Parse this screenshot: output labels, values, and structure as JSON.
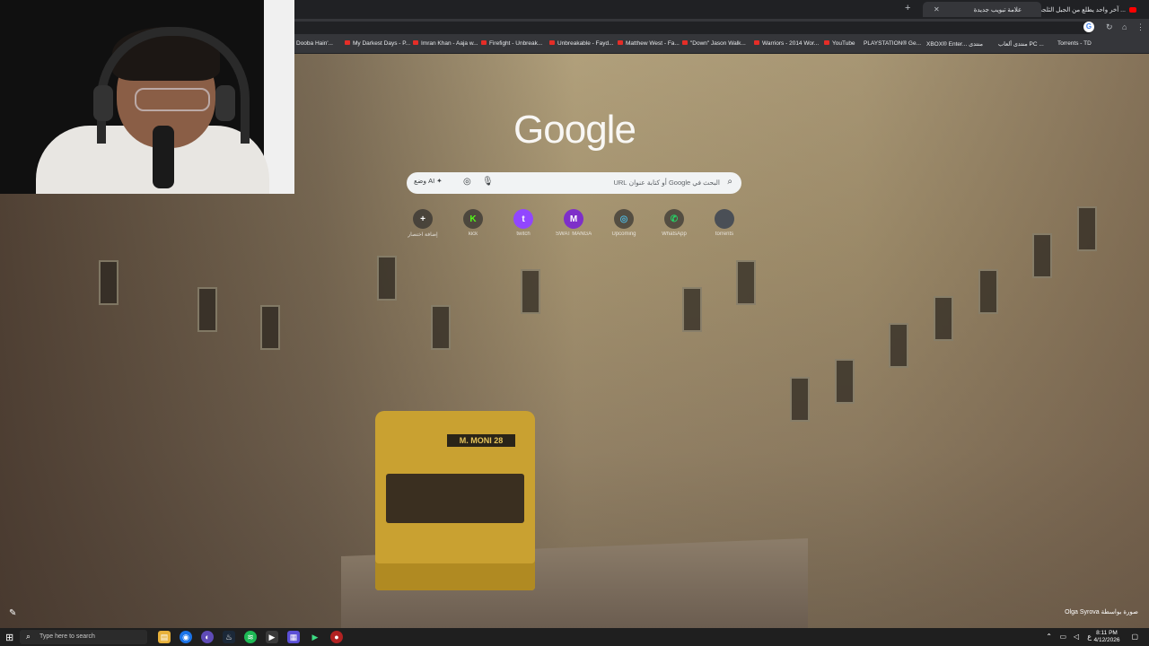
{
  "browser": {
    "tabs": [
      {
        "label": "آخر واحد يطلع من الجبل الثلجي ..."
      },
      {
        "label": "علامة تبويب جديدة"
      }
    ],
    "new_tab_glyph": "+",
    "close_glyph": "✕",
    "google_button": "G"
  },
  "bookmarks": [
    "Dooba Hain'...",
    "My Darkest Days - P...",
    "Imran Khan - Aaja w...",
    "Firefight - Unbreak...",
    "Unbreakable - Fayd...",
    "Matthew West - Fa...",
    "\"Down\" Jason Walk...",
    "Warriors - 2014 Wor...",
    "YouTube",
    "PLAYSTATION® Ge...",
    "XBOX® Enter... منتدى",
    "منتدى ألعاب PC ...",
    "Torrents - TD"
  ],
  "ntp": {
    "logo": "Google",
    "search_placeholder": "البحث في Google أو كتابة عنوان URL",
    "ai_mode": "وضع AI",
    "shortcuts": [
      {
        "label": "إضافة اختصار",
        "glyph": "+",
        "color": "#3c4043"
      },
      {
        "label": "kick",
        "glyph": "K",
        "color": "#53fc18"
      },
      {
        "label": "twitch",
        "glyph": "t",
        "color": "#9146ff"
      },
      {
        "label": "SWAT MANGA",
        "glyph": "M",
        "color": "#7e2fc9"
      },
      {
        "label": "Upcoming",
        "glyph": "◎",
        "color": "#1e88a8"
      },
      {
        "label": "WhatsApp",
        "glyph": "✆",
        "color": "#25d366"
      },
      {
        "label": "torrents",
        "glyph": "",
        "color": "#4a4f56"
      }
    ],
    "credit": "صورة بواسطة Olga Syrova",
    "tram_sign": "M. MONI 28"
  },
  "taskbar": {
    "search_placeholder": "Type here to search",
    "time": "8:11 PM",
    "date": "4/12/2026",
    "lang": "ع"
  }
}
